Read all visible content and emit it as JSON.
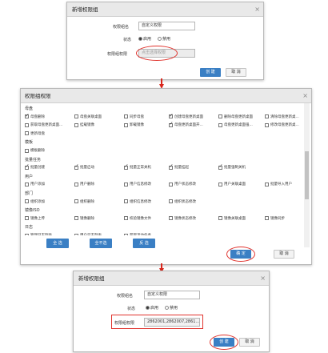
{
  "dialog1": {
    "title": "新增权限组",
    "close": "×",
    "name_label": "权限组名",
    "name_value": "自定义权限",
    "status_label": "状态",
    "status_enabled": "启用",
    "status_disabled": "禁用",
    "perm_label": "权限组权限",
    "perm_placeholder": "点击选择权限",
    "create": "创 建",
    "cancel": "取 消"
  },
  "dialog2": {
    "title": "权限组权限",
    "close": "×",
    "sections": [
      {
        "label": "母盘",
        "items": [
          {
            "label": "母盘删除",
            "checked": true
          },
          {
            "label": "母盘关联桌面",
            "checked": false
          },
          {
            "label": "同步母盘",
            "checked": false
          },
          {
            "label": "创建母盘更新桌面",
            "checked": true
          },
          {
            "label": "删除母盘更新桌面",
            "checked": false
          },
          {
            "label": "清除母盘更新桌...",
            "checked": false
          },
          {
            "label": "获取母盘更新桌面...",
            "checked": false
          },
          {
            "label": "挂载镜像",
            "checked": false
          },
          {
            "label": "卸载镜像",
            "checked": false
          },
          {
            "label": "母盘更新桌面开...",
            "checked": true
          },
          {
            "label": "母盘更新桌面强...",
            "checked": false
          },
          {
            "label": "修改母盘更新桌...",
            "checked": false
          },
          {
            "label": "更新母盘",
            "checked": false
          }
        ]
      },
      {
        "label": "模板",
        "items": [
          {
            "label": "模板删除",
            "checked": false
          }
        ]
      },
      {
        "label": "批量任务",
        "items": [
          {
            "label": "批量创建",
            "checked": true
          },
          {
            "label": "批量启动",
            "checked": true
          },
          {
            "label": "批量正常关机",
            "checked": true
          },
          {
            "label": "批量挂起",
            "checked": true
          },
          {
            "label": "批量强制关机",
            "checked": true
          }
        ]
      },
      {
        "label": "用户",
        "items": [
          {
            "label": "用户添加",
            "checked": false
          },
          {
            "label": "用户删除",
            "checked": false
          },
          {
            "label": "用户信息修改",
            "checked": false
          },
          {
            "label": "用户状态修改",
            "checked": false
          },
          {
            "label": "用户关联桌面",
            "checked": false
          },
          {
            "label": "批量导入用户",
            "checked": false
          }
        ]
      },
      {
        "label": "部门",
        "items": [
          {
            "label": "组织添加",
            "checked": false
          },
          {
            "label": "组织删除",
            "checked": false
          },
          {
            "label": "组织信息修改",
            "checked": false
          },
          {
            "label": "组织状态修改",
            "checked": false
          }
        ]
      },
      {
        "label": "镜像ISO",
        "items": [
          {
            "label": "镜像上传",
            "checked": false
          },
          {
            "label": "镜像删除",
            "checked": false
          },
          {
            "label": "校验镜像文件",
            "checked": false
          },
          {
            "label": "镜像状态修改",
            "checked": false
          },
          {
            "label": "镜像关联桌面",
            "checked": false
          },
          {
            "label": "镜像同步",
            "checked": false
          }
        ]
      },
      {
        "label": "日志",
        "items": [
          {
            "label": "管理日志列表",
            "checked": false
          },
          {
            "label": "用户日志列表",
            "checked": false
          },
          {
            "label": "获取活动任务",
            "checked": false
          }
        ]
      }
    ],
    "select_all": "全 选",
    "select_none": "全不选",
    "invert": "反 选",
    "confirm": "确 定",
    "cancel": "取 消"
  },
  "dialog3": {
    "title": "新增权限组",
    "close": "×",
    "name_label": "权限组名",
    "name_value": "自定义权限",
    "status_label": "状态",
    "status_enabled": "启用",
    "status_disabled": "禁用",
    "perm_label": "权限组权限",
    "perm_value": "2862001,2862007,2861...",
    "create": "创 建",
    "cancel": "取 消"
  },
  "colors": {
    "accent": "#3a7fc4",
    "highlight": "#e0332d",
    "arrow": "#d9261c"
  }
}
